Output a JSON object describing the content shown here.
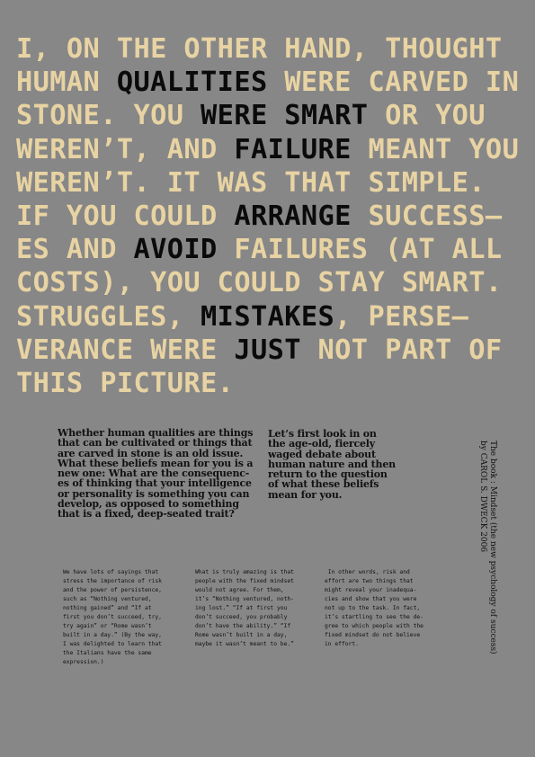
{
  "headline": {
    "lines": [
      [
        {
          "t": "I, ON THE OTHER HAND, THOUGHT",
          "d": 0
        }
      ],
      [
        {
          "t": "HUMAN ",
          "d": 0
        },
        {
          "t": "QUALITIES",
          "d": 1
        },
        {
          "t": " WERE CARVED IN",
          "d": 0
        }
      ],
      [
        {
          "t": "STONE. YOU ",
          "d": 0
        },
        {
          "t": "WERE SMART",
          "d": 1
        },
        {
          "t": " OR YOU",
          "d": 0
        }
      ],
      [
        {
          "t": "WEREN’T, AND ",
          "d": 0
        },
        {
          "t": "FAILURE",
          "d": 1
        },
        {
          "t": " MEANT YOU",
          "d": 0
        }
      ],
      [
        {
          "t": "WEREN’T. IT WAS THAT SIMPLE.",
          "d": 0
        }
      ],
      [
        {
          "t": "IF YOU COULD ",
          "d": 0
        },
        {
          "t": "ARRANGE",
          "d": 1
        },
        {
          "t": " SUCCESS–",
          "d": 0
        }
      ],
      [
        {
          "t": "ES AND ",
          "d": 0
        },
        {
          "t": "AVOID",
          "d": 1
        },
        {
          "t": " FAILURES (AT ALL",
          "d": 0
        }
      ],
      [
        {
          "t": "COSTS), YOU COULD STAY SMART.",
          "d": 0
        }
      ],
      [
        {
          "t": "STRUGGLES, ",
          "d": 0
        },
        {
          "t": "MISTAKES",
          "d": 1
        },
        {
          "t": ", PERSE–",
          "d": 0
        }
      ],
      [
        {
          "t": "VERANCE WERE ",
          "d": 0
        },
        {
          "t": "JUST",
          "d": 1
        },
        {
          "t": " NOT PART OF",
          "d": 0
        }
      ],
      [
        {
          "t": "THIS PICTURE.",
          "d": 0
        }
      ]
    ]
  },
  "column1": {
    "lines": [
      "Whether human qualities are things",
      "that can be cultivated or things that",
      "are carved in stone is an old issue.",
      "What these beliefs mean for you is a",
      "new one: What are the consequenc-",
      "es of thinking that your intelligence",
      "or personality is something you can",
      "develop, as opposed to something",
      "that is a fixed, deep-seated trait?"
    ]
  },
  "column2": {
    "lines": [
      "Let’s first look in on",
      "the age-old, fiercely",
      "waged debate about",
      "human nature and then",
      "return to the question",
      "of what these beliefs",
      "mean for you."
    ]
  },
  "small1": {
    "lines": [
      "We have lots of sayings that",
      "stress the importance of risk",
      "and the power of persistence,",
      "such as “Nothing ventured,",
      "nothing gained” and “If at",
      "first you don’t succeed, try,",
      "try again” or “Rome wasn’t",
      "built in a day.” (By the way,",
      "I was delighted to learn that",
      "the Italians have the same",
      "expression.)"
    ]
  },
  "small2": {
    "lines": [
      "What is truly amazing is that",
      "people with the fixed mindset",
      "would not agree. For them,",
      "it’s “Nothing ventured, noth-",
      "ing lost.” “If at first you",
      "don’t succeed, you probably",
      "don’t have the ability.” “If",
      "Rome wasn’t built in a day,",
      "maybe it wasn’t meant to be.”"
    ]
  },
  "small3": {
    "lines": [
      " In other words, risk and",
      "effort are two things that",
      "might reveal your inadequa-",
      "cies and show that you were",
      "not up to the task. In fact,",
      "it’s startling to see the de-",
      "gree to which people with the",
      "fixed mindset do not believe",
      "in effort."
    ]
  },
  "credit": {
    "title": "The book : Mindset (the new psychology of success)",
    "author": "by CAROL S. DWECK 2006"
  }
}
